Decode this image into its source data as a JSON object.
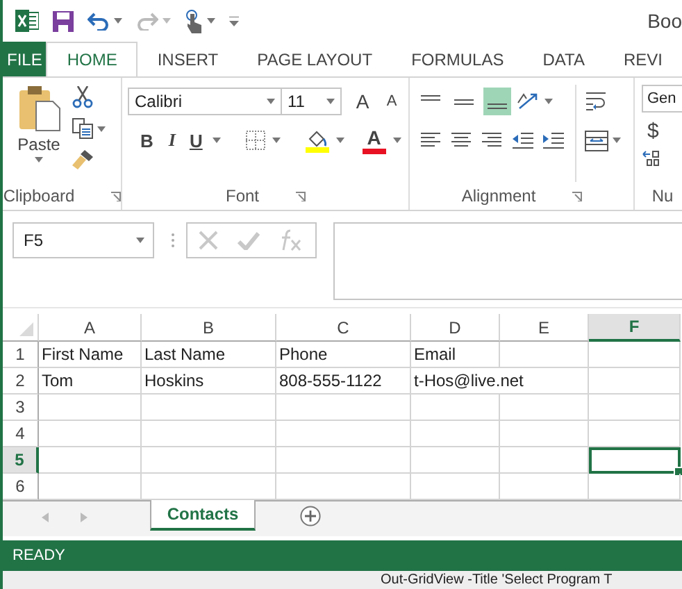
{
  "title_bar": {
    "title": "Boo"
  },
  "ribbon_tabs": [
    {
      "label": "FILE",
      "kind": "file",
      "selected": false
    },
    {
      "label": "HOME",
      "kind": "tab",
      "selected": true
    },
    {
      "label": "INSERT",
      "kind": "tab",
      "selected": false
    },
    {
      "label": "PAGE LAYOUT",
      "kind": "tab",
      "selected": false
    },
    {
      "label": "FORMULAS",
      "kind": "tab",
      "selected": false
    },
    {
      "label": "DATA",
      "kind": "tab",
      "selected": false
    },
    {
      "label": "REVI",
      "kind": "tab",
      "selected": false
    }
  ],
  "ribbon": {
    "paste_label": "Paste",
    "font_name": "Calibri",
    "font_size": "11",
    "grow_font": "A",
    "shrink_font": "A",
    "bold": "B",
    "italic": "I",
    "underline": "U",
    "font_color": "A",
    "number_format": "Gen",
    "currency": "$",
    "vertical_align": [
      {
        "selected": false
      },
      {
        "selected": false
      },
      {
        "selected": true
      }
    ],
    "groups": [
      {
        "label": "Clipboard"
      },
      {
        "label": "Font"
      },
      {
        "label": "Alignment"
      },
      {
        "label": "Nu"
      }
    ]
  },
  "formula_bar": {
    "name_box": "F5"
  },
  "sheet": {
    "columns": [
      {
        "label": "A",
        "selected": false
      },
      {
        "label": "B",
        "selected": false
      },
      {
        "label": "C",
        "selected": false
      },
      {
        "label": "D",
        "selected": false
      },
      {
        "label": "E",
        "selected": false
      },
      {
        "label": "F",
        "selected": true
      }
    ],
    "rows": [
      {
        "header": "1",
        "selected": false,
        "cells": [
          "First Name",
          "Last Name",
          "Phone",
          "Email"
        ]
      },
      {
        "header": "2",
        "selected": false,
        "cells": [
          "Tom",
          "Hoskins",
          "808-555-1122",
          "t-Hos@live.net"
        ]
      },
      {
        "header": "3",
        "selected": false,
        "cells": []
      },
      {
        "header": "4",
        "selected": false,
        "cells": []
      },
      {
        "header": "5",
        "selected": true,
        "cells": []
      },
      {
        "header": "6",
        "selected": false,
        "cells": []
      }
    ]
  },
  "sheet_tabs": [
    {
      "label": "Contacts",
      "selected": true
    }
  ],
  "status_bar": {
    "text": "READY"
  },
  "background_window": {
    "text": "Out-GridView -Title 'Select Program T"
  }
}
